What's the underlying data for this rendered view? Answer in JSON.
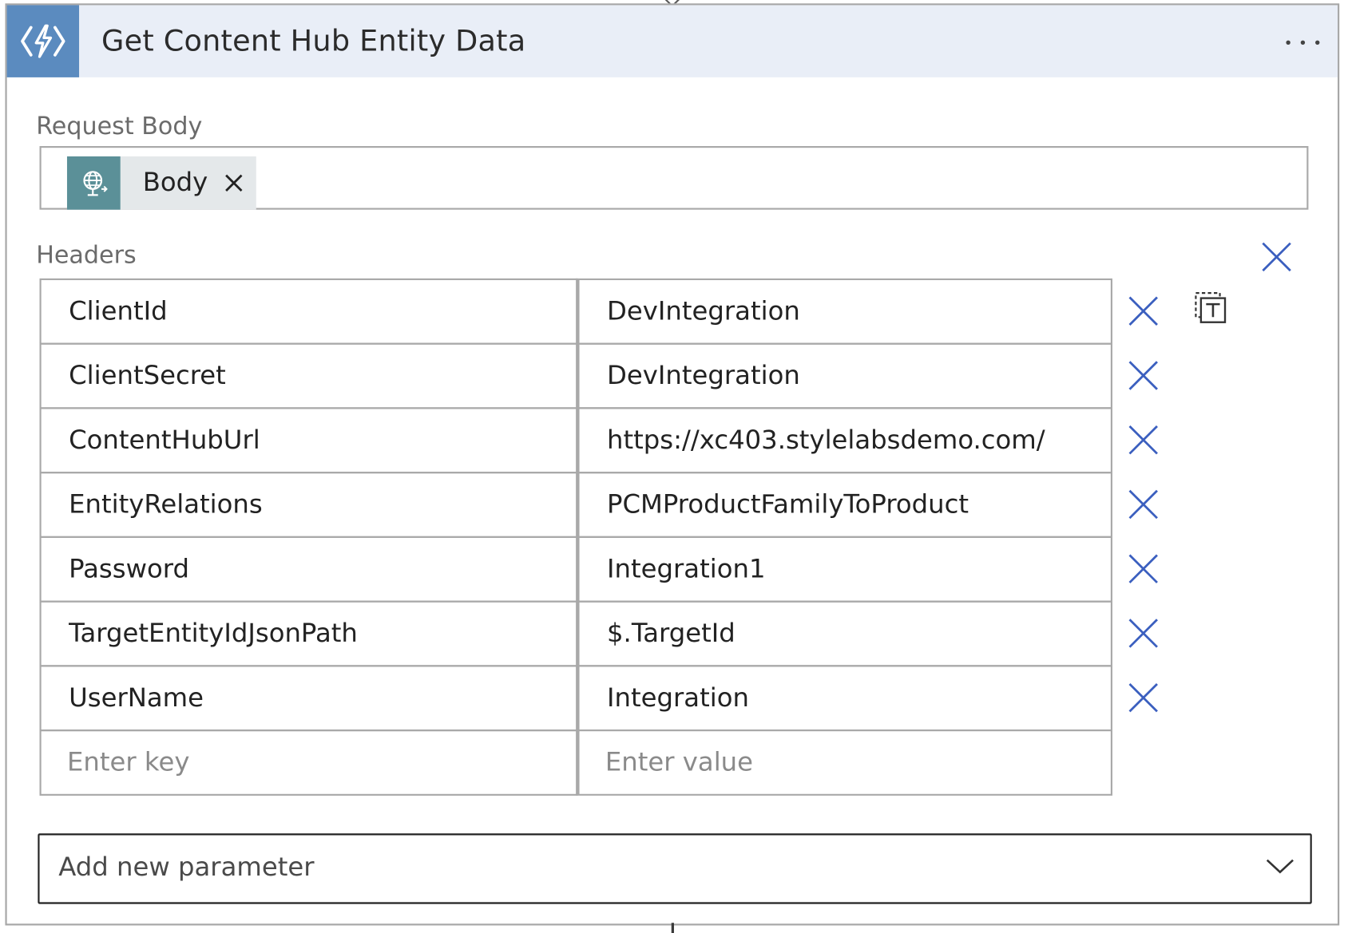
{
  "action": {
    "title": "Get Content Hub Entity Data",
    "icon": "azure-function-icon",
    "menu_icon": "more-horizontal-icon",
    "header_color": "#e9eef7",
    "icon_bg_color": "#5b8bbf"
  },
  "request_body": {
    "label": "Request Body",
    "token": {
      "label": "Body",
      "icon": "http-globe-icon",
      "icon_bg_color": "#5b9098",
      "remove_icon": "close-icon"
    }
  },
  "headers": {
    "label": "Headers",
    "clear_icon": "close-icon",
    "switch_mode_icon": "text-mode-icon",
    "rows": [
      {
        "key": "ClientId",
        "value": "DevIntegration"
      },
      {
        "key": "ClientSecret",
        "value": "DevIntegration"
      },
      {
        "key": "ContentHubUrl",
        "value": "https://xc403.stylelabsdemo.com/"
      },
      {
        "key": "EntityRelations",
        "value": "PCMProductFamilyToProduct"
      },
      {
        "key": "Password",
        "value": "Integration1"
      },
      {
        "key": "TargetEntityIdJsonPath",
        "value": "$.TargetId"
      },
      {
        "key": "UserName",
        "value": "Integration"
      }
    ],
    "new_row": {
      "key_placeholder": "Enter key",
      "value_placeholder": "Enter value"
    },
    "delete_icon_color": "#3b5fbf"
  },
  "add_parameter": {
    "label": "Add new parameter",
    "icon": "chevron-down-icon"
  }
}
